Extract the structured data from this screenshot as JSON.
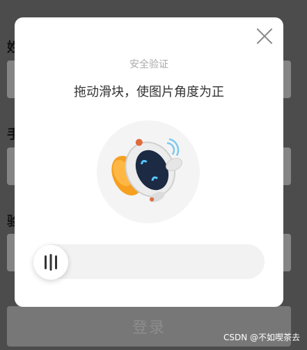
{
  "form": {
    "label1": "姓",
    "label2": "手",
    "label3": "验",
    "login_button": "登录"
  },
  "modal": {
    "subtitle": "安全验证",
    "title": "拖动滑块，使图片角度为正",
    "image_icon": "robot-mascot-icon",
    "slider": {
      "progress": 0,
      "handle_icon": "grip-lines-icon"
    },
    "close_icon": "close-icon"
  },
  "watermark": "CSDN @不如喫茶去",
  "colors": {
    "overlay": "#8a8a8a",
    "modal_bg": "#ffffff",
    "track": "#f2f2f2"
  }
}
